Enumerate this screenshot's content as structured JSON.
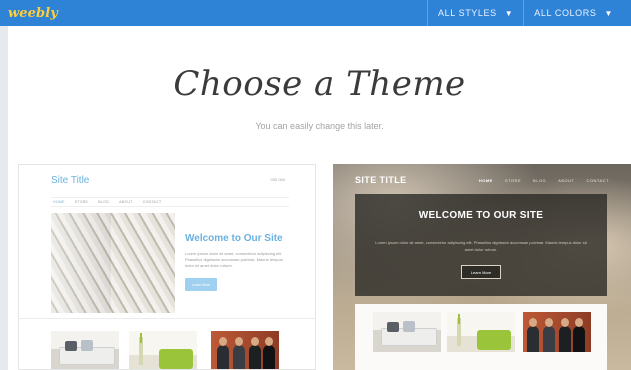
{
  "topbar": {
    "logo": "weebly",
    "filters": [
      {
        "label": "ALL STYLES"
      },
      {
        "label": "ALL COLORS"
      }
    ],
    "background": "#2f83d6",
    "logo_color": "#ffcf3a"
  },
  "hero": {
    "title": "Choose a Theme",
    "subtitle": "You can easily change this later."
  },
  "themes": [
    {
      "site_title": "Site Title",
      "top_right_text": "000 000",
      "nav": [
        "HOME",
        "STORE",
        "BLOG",
        "ABOUT",
        "CONTACT"
      ],
      "welcome": "Welcome to Our Site",
      "lorem": "Lorem ipsum dolor sit amet, consectetur adipiscing elit. Phasellus dignissim accumsan pulvinar. Mauris tempus dolor sit amet dolor rutrum.",
      "button": "Learn More",
      "accent": "#6cb1df"
    },
    {
      "site_title": "SITE TITLE",
      "nav": [
        "HOME",
        "STORE",
        "BLOG",
        "ABOUT",
        "CONTACT"
      ],
      "welcome": "WELCOME TO OUR SITE",
      "lorem": "Lorem ipsum dolor sit amet, consectetur adipiscing elit. Phasellus dignissim accumsan pulvinar. Mauris tempus dolor sit amet dolor rutrum.",
      "button": "Learn More"
    }
  ]
}
